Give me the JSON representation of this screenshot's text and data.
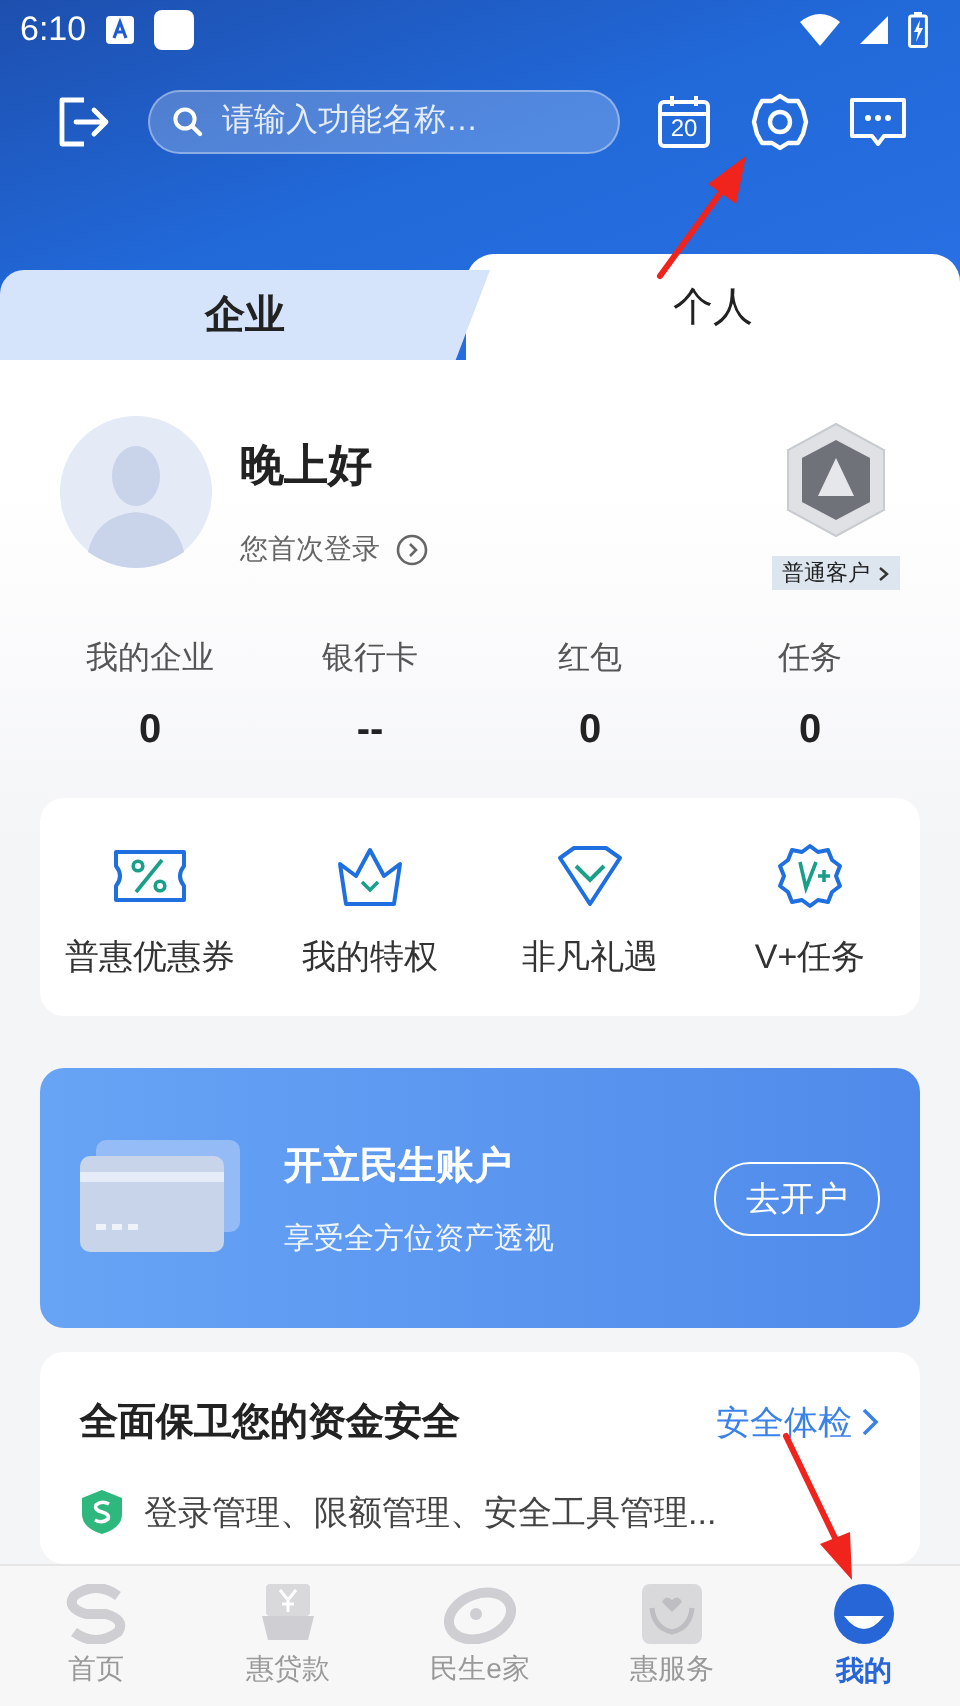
{
  "status_bar": {
    "time": "6:10"
  },
  "header": {
    "search": {
      "placeholder": "请输入功能名称…"
    },
    "calendar_day": "20"
  },
  "tabs": [
    {
      "label": "企业",
      "selected": false
    },
    {
      "label": "个人",
      "selected": true
    }
  ],
  "profile": {
    "greeting": "晚上好",
    "subtitle": "您首次登录",
    "member_level": "普通客户"
  },
  "stats": [
    {
      "label": "我的企业",
      "value": "0"
    },
    {
      "label": "银行卡",
      "value": "--"
    },
    {
      "label": "红包",
      "value": "0"
    },
    {
      "label": "任务",
      "value": "0"
    }
  ],
  "features": [
    {
      "label": "普惠优惠券"
    },
    {
      "label": "我的特权"
    },
    {
      "label": "非凡礼遇"
    },
    {
      "label": "V+任务"
    }
  ],
  "banner": {
    "title": "开立民生账户",
    "subtitle": "享受全方位资产透视",
    "button": "去开户"
  },
  "security": {
    "title": "全面保卫您的资金安全",
    "link": "安全体检",
    "description": "登录管理、限额管理、安全工具管理..."
  },
  "bottom_nav": [
    {
      "label": "首页",
      "selected": false
    },
    {
      "label": "惠贷款",
      "selected": false
    },
    {
      "label": "民生e家",
      "selected": false
    },
    {
      "label": "惠服务",
      "selected": false
    },
    {
      "label": "我的",
      "selected": true
    }
  ]
}
